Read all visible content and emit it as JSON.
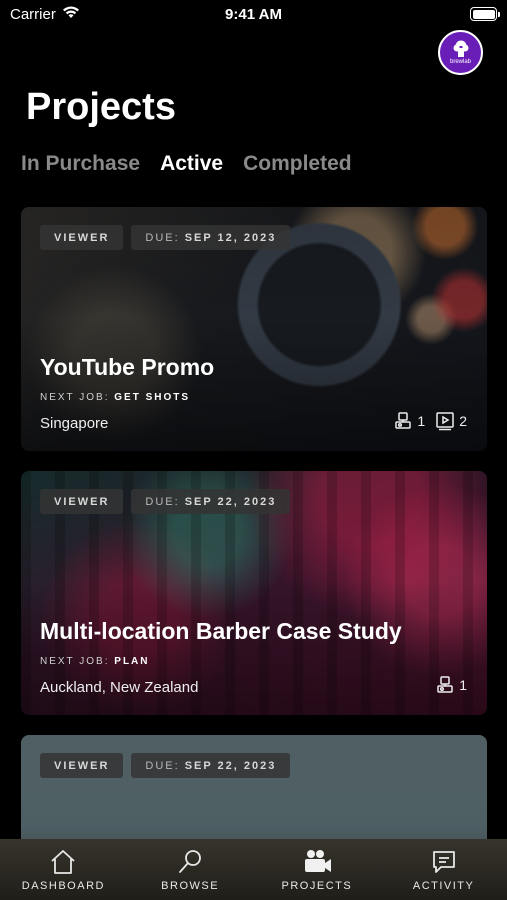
{
  "status_bar": {
    "carrier": "Carrier",
    "time": "9:41 AM"
  },
  "avatar": {
    "text": "brewlab"
  },
  "header": {
    "title": "Projects"
  },
  "tabs": [
    {
      "label": "In Purchase"
    },
    {
      "label": "Active"
    },
    {
      "label": "Completed"
    }
  ],
  "cards": [
    {
      "role": "VIEWER",
      "due_label": "DUE:",
      "due_date": "SEP 12, 2023",
      "title": "YouTube Promo",
      "next_job_label": "NEXT JOB:",
      "next_job": "GET SHOTS",
      "location": "Singapore",
      "crew_count": "1",
      "video_count": "2"
    },
    {
      "role": "VIEWER",
      "due_label": "DUE:",
      "due_date": "SEP 22, 2023",
      "title": "Multi-location Barber Case Study",
      "next_job_label": "NEXT JOB:",
      "next_job": "PLAN",
      "location": "Auckland, New Zealand",
      "crew_count": "1"
    },
    {
      "role": "VIEWER",
      "due_label": "DUE:",
      "due_date": "SEP 22, 2023"
    }
  ],
  "tab_bar": [
    {
      "label": "DASHBOARD",
      "icon": "home-icon"
    },
    {
      "label": "BROWSE",
      "icon": "search-icon"
    },
    {
      "label": "PROJECTS",
      "icon": "video-camera-icon"
    },
    {
      "label": "ACTIVITY",
      "icon": "chat-icon"
    }
  ]
}
